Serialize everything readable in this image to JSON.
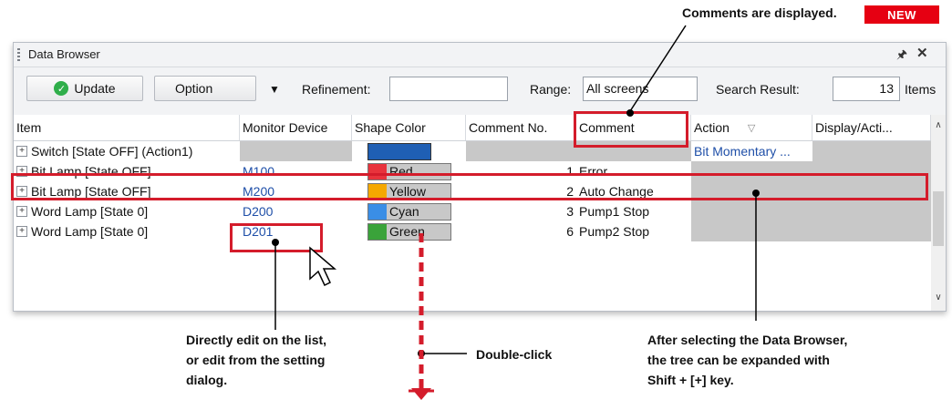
{
  "annotations": {
    "top_note": "Comments are displayed.",
    "new_badge": "NEW",
    "left_note": [
      "Directly edit on the list,",
      "or edit from the setting",
      "dialog."
    ],
    "mid_note": "Double-click",
    "right_note": [
      "After selecting the Data Browser,",
      "the tree can be expanded with",
      "Shift + [+] key."
    ]
  },
  "window": {
    "title": "Data Browser",
    "pin_icon": "pin-icon",
    "close_icon": "close-icon"
  },
  "toolbar": {
    "update_label": "Update",
    "option_label": "Option",
    "refinement_label": "Refinement:",
    "refinement_value": "",
    "range_label": "Range:",
    "range_value": "All screens",
    "search_result_label": "Search Result:",
    "search_result_value": "13",
    "items_label": "Items"
  },
  "table": {
    "columns": [
      "Item",
      "Monitor Device",
      "Shape Color",
      "Comment No.",
      "Comment",
      "Action",
      "Display/Acti..."
    ],
    "rows": [
      {
        "item": "Switch [State OFF] (Action1)",
        "device": "",
        "color_name": "",
        "color": "#1f5fb4",
        "comment_no": "",
        "comment": "",
        "action": "Bit Momentary ..."
      },
      {
        "item": "Bit Lamp [State OFF]",
        "device": "M100",
        "color_name": "Red",
        "color": "#e8333c",
        "comment_no": "1",
        "comment": "Error",
        "action": ""
      },
      {
        "item": "Bit Lamp [State OFF]",
        "device": "M200",
        "color_name": "Yellow",
        "color": "#f5a800",
        "comment_no": "2",
        "comment": "Auto Change",
        "action": ""
      },
      {
        "item": "Word Lamp [State 0]",
        "device": "D200",
        "color_name": "Cyan",
        "color": "#3a8ee6",
        "comment_no": "3",
        "comment": "Pump1 Stop",
        "action": ""
      },
      {
        "item": "Word Lamp [State 0]",
        "device": "D201",
        "color_name": "Green",
        "color": "#3aa33a",
        "comment_no": "6",
        "comment": "Pump2 Stop",
        "action": ""
      }
    ]
  },
  "colors": {
    "accent_red": "#d41c2b",
    "link_blue": "#1f4fa8",
    "gray_cell": "#c8c8c8"
  }
}
